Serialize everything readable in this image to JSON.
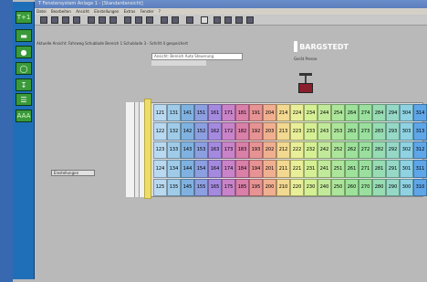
{
  "window": {
    "title": "T Fenstersystem Anlage 1 - [Standardansicht]"
  },
  "menubar": {
    "items": [
      "Datei",
      "Bearbeiten",
      "Ansicht",
      "Einstellungen",
      "Extras",
      "Fenster",
      "?"
    ]
  },
  "toolstrip": {
    "buttons": [
      {
        "icon": "run-icon",
        "label": "T+1"
      },
      {
        "icon": "car-icon",
        "label": ""
      },
      {
        "icon": "circle-icon",
        "label": ""
      },
      {
        "icon": "ring-icon",
        "label": ""
      },
      {
        "icon": "lift-icon",
        "label": ""
      },
      {
        "icon": "stack-icon",
        "label": ""
      },
      {
        "icon": "grid-icon",
        "label": "AAA"
      }
    ]
  },
  "address": {
    "text": "Aktuelle Ansicht: Fahrweg Schublade Bereich 1 Schublade 3 - Schritt 4 gespeichert"
  },
  "header": {
    "line1": "Ansicht: Bereich Auto Steuerung"
  },
  "brand": {
    "name": "BARGSTEDT",
    "subtitle": "Gerät Presse"
  },
  "side_label": {
    "text": "Einstellungen"
  },
  "grid": {
    "rows": [
      [
        "121",
        "131",
        "141",
        "151",
        "161",
        "171",
        "181",
        "191",
        "204",
        "214",
        "224",
        "234",
        "244",
        "254",
        "264",
        "274",
        "284",
        "294",
        "304",
        "314"
      ],
      [
        "122",
        "132",
        "142",
        "152",
        "162",
        "172",
        "182",
        "192",
        "203",
        "213",
        "223",
        "233",
        "243",
        "253",
        "263",
        "273",
        "283",
        "293",
        "303",
        "313"
      ],
      [
        "123",
        "133",
        "143",
        "153",
        "163",
        "173",
        "183",
        "193",
        "202",
        "212",
        "222",
        "232",
        "242",
        "252",
        "262",
        "272",
        "282",
        "292",
        "302",
        "312"
      ],
      [
        "124",
        "134",
        "144",
        "154",
        "164",
        "174",
        "184",
        "194",
        "201",
        "211",
        "221",
        "231",
        "241",
        "251",
        "261",
        "271",
        "281",
        "291",
        "301",
        "311"
      ],
      [
        "125",
        "135",
        "145",
        "155",
        "165",
        "175",
        "185",
        "195",
        "200",
        "210",
        "220",
        "230",
        "240",
        "250",
        "260",
        "270",
        "280",
        "290",
        "300",
        "310"
      ]
    ],
    "column_colors": [
      "#b9d9f0",
      "#9fcbe8",
      "#7fb2e0",
      "#8c9fe0",
      "#a48adf",
      "#c983c9",
      "#d97fa8",
      "#e79393",
      "#f0b090",
      "#f2d890",
      "#e9ef98",
      "#d5ef94",
      "#c1e99a",
      "#ade59a",
      "#9de19a",
      "#9adf9e",
      "#97dcb2",
      "#95d8c6",
      "#8fd2e2",
      "#5ea6e8"
    ]
  }
}
